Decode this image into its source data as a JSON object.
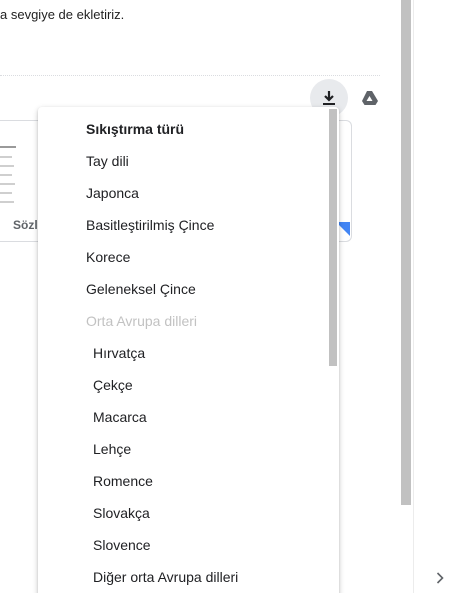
{
  "email": {
    "body_text": "a sevgiye de ekletiriz.",
    "attachment_chip": "Sözlü",
    "download_icon": "download-icon",
    "drive_icon": "drive-icon"
  },
  "menu": {
    "header": "Sıkıştırma türü",
    "items": [
      "Tay dili",
      "Japonca",
      "Basitleştirilmiş Çince",
      "Korece",
      "Geleneksel Çince"
    ],
    "group_label": "Orta Avrupa dilleri",
    "sub_items": [
      "Hırvatça",
      "Çekçe",
      "Macarca",
      "Lehçe",
      "Romence",
      "Slovakça",
      "Slovence",
      "Diğer orta Avrupa dilleri"
    ]
  },
  "colors": {
    "accent": "#4285f4",
    "disabled": "#c2c2c2"
  }
}
